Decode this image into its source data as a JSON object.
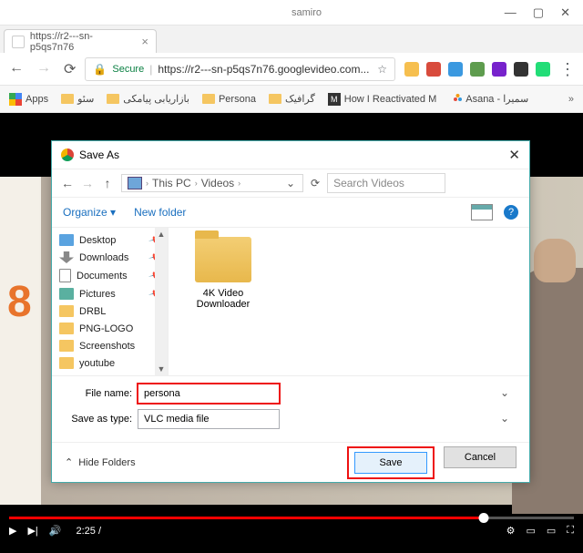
{
  "titlebar": {
    "user": "samiro"
  },
  "tab": {
    "title": "https://r2---sn-p5qs7n76"
  },
  "url": {
    "secure": "Secure",
    "text": "https://r2---sn-p5qs7n76.googlevideo.com..."
  },
  "bookmarks": {
    "apps": "Apps",
    "b1": "سئو",
    "b2": "بازاریابی پیامکی",
    "b3": "Persona",
    "b4": "گرافیک",
    "b5": "How I Reactivated M",
    "b6": "Asana - سمیرا"
  },
  "video": {
    "time": "2:25 /"
  },
  "dialog": {
    "title": "Save As",
    "crumb1": "This PC",
    "crumb2": "Videos",
    "search_ph": "Search Videos",
    "organize": "Organize ▾",
    "newfolder": "New folder",
    "side": {
      "desktop": "Desktop",
      "downloads": "Downloads",
      "documents": "Documents",
      "pictures": "Pictures",
      "drbl": "DRBL",
      "png": "PNG-LOGO",
      "ss": "Screenshots",
      "yt": "youtube"
    },
    "folder": "4K Video Downloader",
    "fn_label": "File name:",
    "fn_value": "persona",
    "ft_label": "Save as type:",
    "ft_value": "VLC media file",
    "hide": "Hide Folders",
    "save": "Save",
    "cancel": "Cancel"
  }
}
